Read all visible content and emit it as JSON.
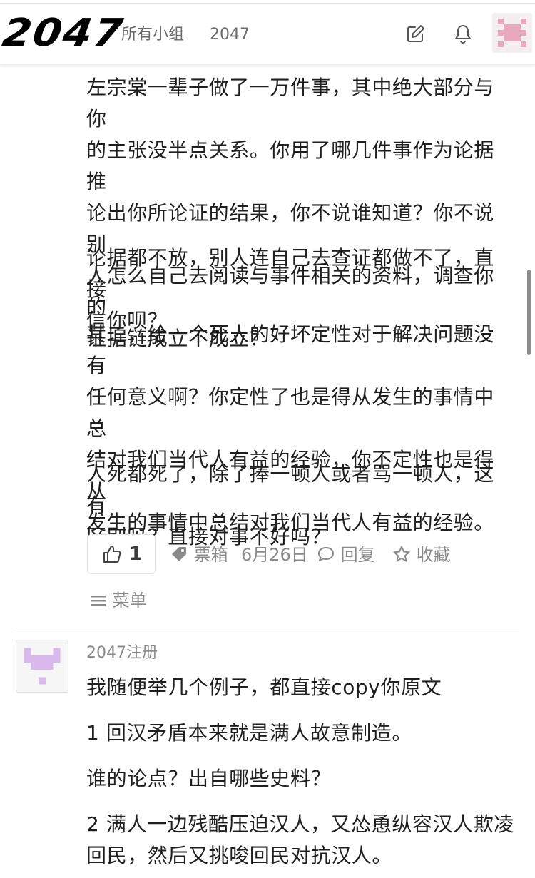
{
  "header": {
    "logo": "2047",
    "nav_groups": "所有小组",
    "nav_2047": "2047",
    "icons": [
      "edit-icon",
      "bell-icon"
    ],
    "avatar_color": "#e8a9bf"
  },
  "post": {
    "paragraphs": [
      "左宗棠一辈子做了一万件事，其中绝大部分与你\n的主张没半点关系。你用了哪几件事作为论据推\n论出你所论证的结果，你不说谁知道？你不说别\n人怎么自己去阅读与事件相关的资料，调查你的\n证据链成立不成立？",
      "论据都不放，别人连自己去查证都做不了，直接\n信你呗？",
      "其二，给一个死人的好坏定性对于解决问题没有\n任何意义啊？你定性了也是得从发生的事情中总\n结对我们当代人有益的经验，你不定性也是得从\n发生的事情中总结对我们当代人有益的经验。",
      "人死都死了，除了捧一顿人或者骂一顿人，这有\n区别吗？直接对事不好吗？"
    ],
    "actions": {
      "like_count": "1",
      "ticket": "票箱",
      "date": "6月26日",
      "reply": "回复",
      "favorite": "收藏",
      "menu": "菜单"
    }
  },
  "comment": {
    "author": "2047注册",
    "avatar_color": "#d9b8ee",
    "paragraphs": [
      "我随便举几个例子，都直接copy你原文",
      "1 回汉矛盾本来就是满人故意制造。",
      "谁的论点？出自哪些史料？",
      "2 满人一边残酷压迫汉人，又怂恿纵容汉人欺凌\n回民，然后又挑唆回民对抗汉人。"
    ]
  }
}
